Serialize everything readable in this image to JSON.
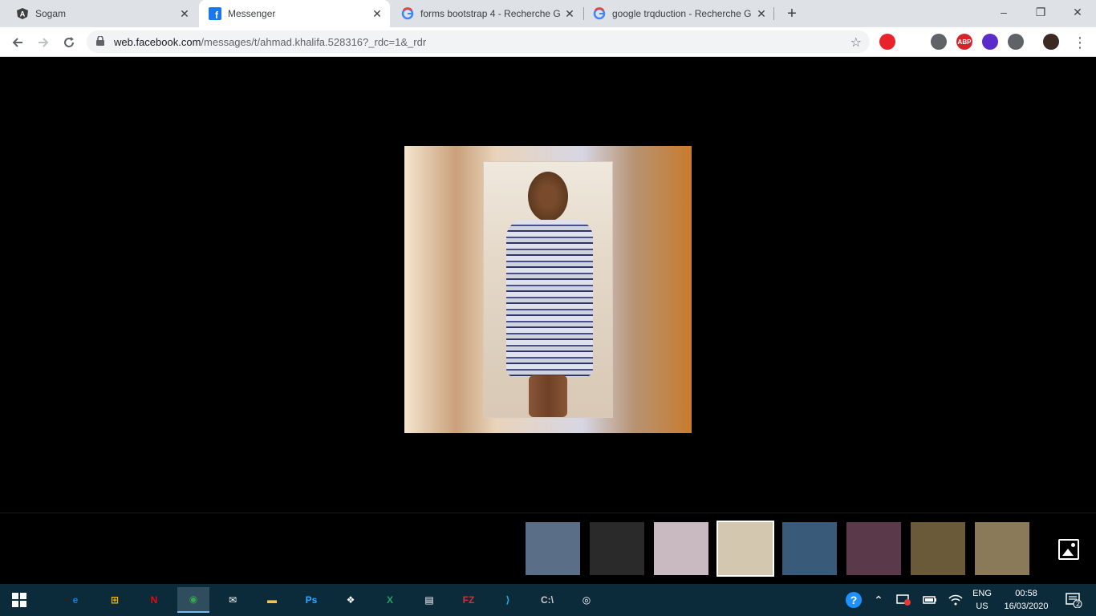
{
  "browser": {
    "tabs": [
      {
        "title": "Sogam",
        "favicon": "angular-icon",
        "active": false
      },
      {
        "title": "Messenger",
        "favicon": "facebook-icon",
        "active": true
      },
      {
        "title": "forms bootstrap 4 - Recherche G",
        "favicon": "google-icon",
        "active": false
      },
      {
        "title": "google trqduction - Recherche G",
        "favicon": "google-icon",
        "active": false
      }
    ],
    "close_glyph": "✕",
    "new_tab_glyph": "+",
    "window_controls": {
      "minimize": "–",
      "maximize": "❐",
      "close": "✕"
    },
    "url_host": "web.facebook.com",
    "url_path": "/messages/t/ahmad.khalifa.528316?_rdc=1&_rdr"
  },
  "extensions": [
    {
      "name": "stop-extension-icon",
      "color": "#e8232b",
      "label": ""
    },
    {
      "name": "dark-reader-icon",
      "color": "#5f6368",
      "label": ""
    },
    {
      "name": "adblock-plus-icon",
      "color": "#d6252a",
      "label": "ABP"
    },
    {
      "name": "purple-extension-icon",
      "color": "#5b2cc9",
      "label": ""
    },
    {
      "name": "code-extension-icon",
      "color": "#5f6368",
      "label": ""
    },
    {
      "name": "profile-avatar",
      "color": "#3b2a22",
      "label": ""
    }
  ],
  "viewer": {
    "main_photo": "woman-in-striped-dress-photo",
    "thumbnails": [
      {
        "name": "thumb-chat-screenshot",
        "color": "#5a6f87",
        "active": false
      },
      {
        "name": "thumb-dark-screenshot",
        "color": "#2a2a2a",
        "active": false
      },
      {
        "name": "thumb-blurred-photo",
        "color": "#c9b9c0",
        "active": false
      },
      {
        "name": "thumb-striped-dress",
        "color": "#d4c7b0",
        "active": true
      },
      {
        "name": "thumb-phone-screenshot",
        "color": "#3a5a7a",
        "active": false
      },
      {
        "name": "thumb-portrait",
        "color": "#5a3a4a",
        "active": false
      },
      {
        "name": "thumb-landscape",
        "color": "#6a5a3a",
        "active": false
      },
      {
        "name": "thumb-outdoor",
        "color": "#8a7a5a",
        "active": false
      }
    ]
  },
  "taskbar": {
    "apps": [
      {
        "name": "edge-icon",
        "glyph": "e",
        "color": "#1a7fd4",
        "active": false
      },
      {
        "name": "store-icon",
        "glyph": "⊞",
        "color": "#f4b400",
        "active": false
      },
      {
        "name": "netflix-icon",
        "glyph": "N",
        "color": "#e50914",
        "active": false
      },
      {
        "name": "chrome-icon",
        "glyph": "◉",
        "color": "#34a853",
        "active": true
      },
      {
        "name": "mail-icon",
        "glyph": "✉",
        "color": "#ffffff",
        "active": false
      },
      {
        "name": "explorer-icon",
        "glyph": "▬",
        "color": "#f6c342",
        "active": false
      },
      {
        "name": "photoshop-icon",
        "glyph": "Ps",
        "color": "#31a8ff",
        "active": false
      },
      {
        "name": "dropbox-icon",
        "glyph": "❖",
        "color": "#ffffff",
        "active": false
      },
      {
        "name": "excel-icon",
        "glyph": "X",
        "color": "#21a366",
        "active": false
      },
      {
        "name": "video-editor-icon",
        "glyph": "▤",
        "color": "#ffffff",
        "active": false
      },
      {
        "name": "filezilla-icon",
        "glyph": "FZ",
        "color": "#d32f2f",
        "active": false
      },
      {
        "name": "vscode-icon",
        "glyph": "⟩",
        "color": "#23a9f2",
        "active": false
      },
      {
        "name": "terminal-icon",
        "glyph": "C:\\",
        "color": "#cccccc",
        "active": false
      },
      {
        "name": "groove-icon",
        "glyph": "◎",
        "color": "#ffffff",
        "active": false
      }
    ],
    "lang_top": "ENG",
    "lang_bottom": "US",
    "time": "00:58",
    "date": "16/03/2020",
    "notifications": "2"
  }
}
